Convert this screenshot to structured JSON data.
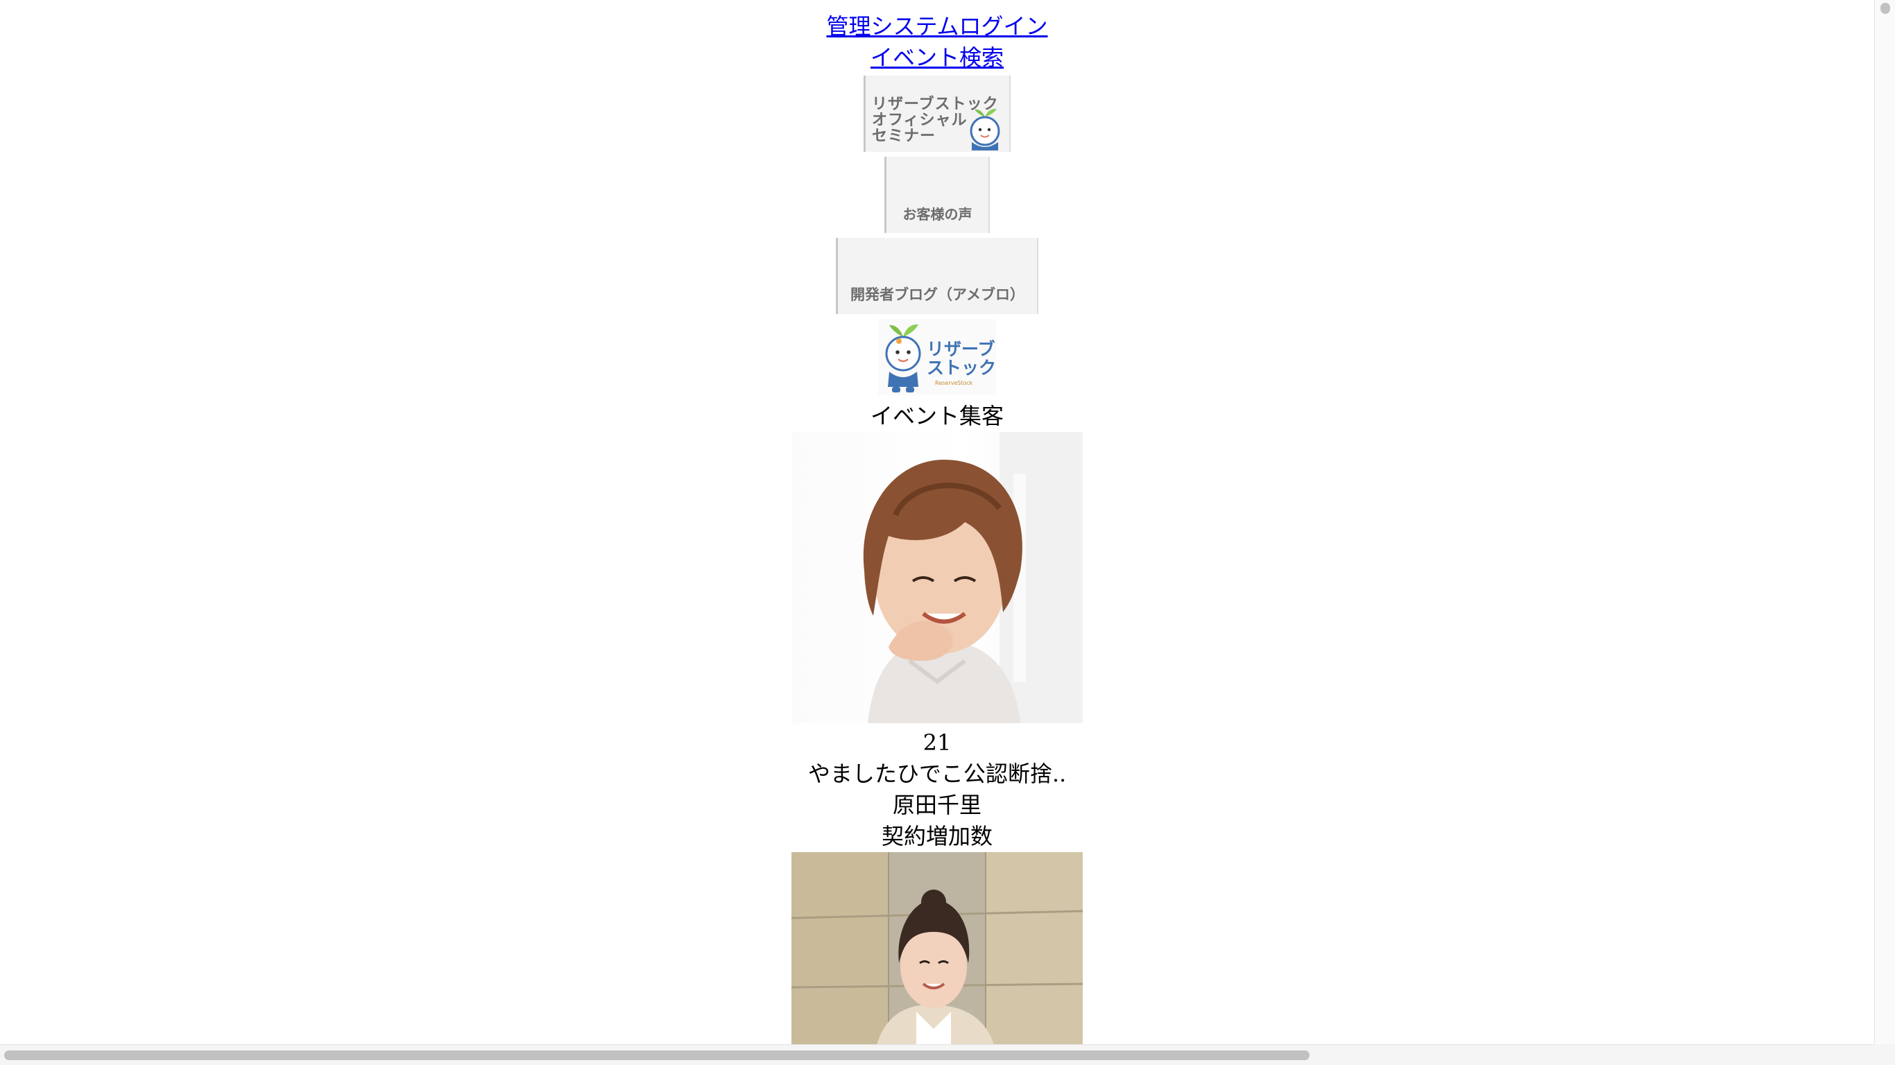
{
  "nav": {
    "admin_login": "管理システムログイン",
    "event_search": "イベント検索"
  },
  "banners": {
    "seminar": {
      "line1": "リザーブストック",
      "line2": "オフィシャル",
      "line3": "セミナー"
    },
    "customer_voice": "お客様の声",
    "developer_blog": "開発者ブログ（アメブロ）"
  },
  "logo": {
    "line1": "リザーブ",
    "line2": "ストック",
    "sub": "ReserveStock"
  },
  "section_label": "イベント集客",
  "cards": [
    {
      "rank": "21",
      "title": "やましたひでこ公認断捨..",
      "name": "原田千里",
      "metric": "契約増加数"
    }
  ],
  "colors": {
    "link": "#0000ee",
    "logo_blue": "#3f73b4",
    "banner_bg": "#f3f3f3"
  }
}
